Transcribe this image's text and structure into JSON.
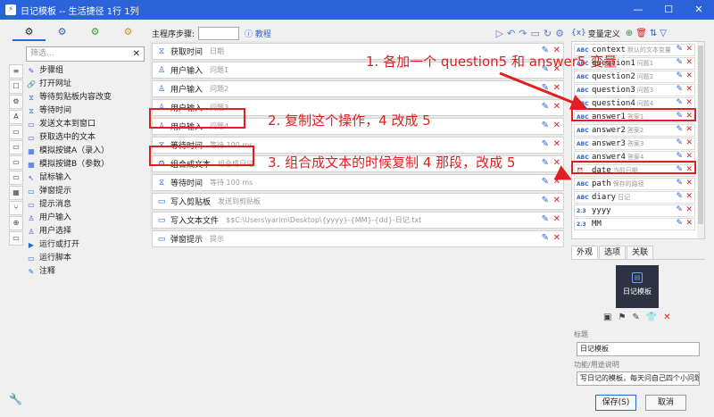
{
  "window": {
    "title": "日记模板 -- 生活捷径 1行 1列",
    "controls": [
      "—",
      "☐",
      "✕"
    ]
  },
  "top_tabs": [
    "⚙",
    "⚙",
    "⚙",
    "⚙"
  ],
  "left_vtool": [
    "≡",
    "☐",
    "⚙",
    "A",
    "▭",
    "▭",
    "▭",
    "▭",
    "▦",
    "⑂",
    "⊕",
    "▭"
  ],
  "filter": {
    "placeholder": "筛选..."
  },
  "actions": [
    {
      "icon": "✎",
      "label": "步骤组"
    },
    {
      "icon": "🔗",
      "label": "打开网址"
    },
    {
      "icon": "⧖",
      "label": "等待剪贴板内容改变"
    },
    {
      "icon": "⧖",
      "label": "等待时间"
    },
    {
      "icon": "▭",
      "label": "发送文本到窗口"
    },
    {
      "icon": "▭",
      "label": "获取选中的文本"
    },
    {
      "icon": "▦",
      "label": "模拟按键A（录入）"
    },
    {
      "icon": "▦",
      "label": "模拟按键B（参数）"
    },
    {
      "icon": "↖",
      "label": "鼠标输入"
    },
    {
      "icon": "▭",
      "label": "弹窗提示"
    },
    {
      "icon": "▭",
      "label": "提示消息"
    },
    {
      "icon": "♙",
      "label": "用户输入"
    },
    {
      "icon": "♙",
      "label": "用户选择"
    },
    {
      "icon": "▶",
      "label": "运行或打开"
    },
    {
      "icon": "▭",
      "label": "运行脚本"
    },
    {
      "icon": "✎",
      "label": "注释"
    }
  ],
  "sequence": {
    "label": "主程序步骤:",
    "help": "教程"
  },
  "steps": [
    {
      "icon": "⧖",
      "name": "获取时间",
      "sub": "日期"
    },
    {
      "icon": "♙",
      "name": "用户输入",
      "sub": "问题1"
    },
    {
      "icon": "♙",
      "name": "用户输入",
      "sub": "问题2"
    },
    {
      "icon": "♙",
      "name": "用户输入",
      "sub": "问题3"
    },
    {
      "icon": "♙",
      "name": "用户输入",
      "sub": "问题4"
    },
    {
      "icon": "⧖",
      "name": "等待时间",
      "sub": "等待 100 ms"
    },
    {
      "icon": "⚙",
      "name": "组合成文本",
      "sub": "组合成日记"
    },
    {
      "icon": "⧖",
      "name": "等待时间",
      "sub": "等待 100 ms"
    },
    {
      "icon": "▭",
      "name": "写入剪贴板",
      "sub": "发送到剪贴板"
    },
    {
      "icon": "▭",
      "name": "写入文本文件",
      "sub": "$$C:\\Users\\yarim\\Desktop\\{yyyy}-{MM}-{dd}-日记.txt"
    },
    {
      "icon": "▭",
      "name": "弹窗提示",
      "sub": "提示"
    }
  ],
  "vars_header": {
    "label": "变量定义"
  },
  "variables": [
    {
      "type": "ABC",
      "name": "context",
      "desc": "默认的文本变量"
    },
    {
      "type": "ABC",
      "name": "question1",
      "desc": "问题1"
    },
    {
      "type": "ABC",
      "name": "question2",
      "desc": "问题2"
    },
    {
      "type": "ABC",
      "name": "question3",
      "desc": "问题3"
    },
    {
      "type": "ABC",
      "name": "question4",
      "desc": "问题4"
    },
    {
      "type": "ABC",
      "name": "answer1",
      "desc": "答案1"
    },
    {
      "type": "ABC",
      "name": "answer2",
      "desc": "答案2"
    },
    {
      "type": "ABC",
      "name": "answer3",
      "desc": "答案3"
    },
    {
      "type": "ABC",
      "name": "answer4",
      "desc": "答案4"
    },
    {
      "type": "⏰",
      "name": "date",
      "desc": "当前日期"
    },
    {
      "type": "ABC",
      "name": "path",
      "desc": "保存的路径"
    },
    {
      "type": "ABC",
      "name": "diary",
      "desc": "日记"
    },
    {
      "type": "2.3",
      "name": "yyyy",
      "desc": ""
    },
    {
      "type": "2.3",
      "name": "MM",
      "desc": ""
    }
  ],
  "prop_tabs": [
    "外观",
    "选项",
    "关联"
  ],
  "preview": {
    "label": "日记模板"
  },
  "props": {
    "title_label": "标题",
    "title_value": "日记模板",
    "desc_label": "功能/用途说明",
    "desc_value": "写日记的模板，每天问自己四个小问题"
  },
  "buttons": {
    "save": "保存(S)",
    "cancel": "取消"
  },
  "annotations": {
    "a1": "1. 各加一个 question5 和 answer5 变量",
    "a2": "2. 复制这个操作，4 改成 5",
    "a3": "3. 组合成文本的时候复制 4 那段，改成 5"
  },
  "colors": {
    "accent": "#2b63d9",
    "annotation": "#e02020"
  }
}
